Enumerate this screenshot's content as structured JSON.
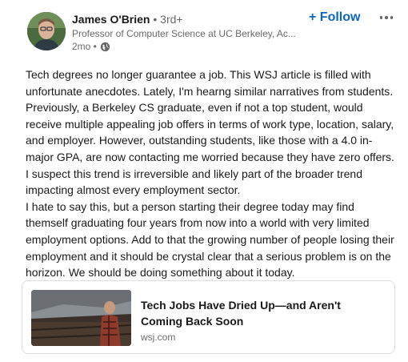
{
  "author": {
    "name": "James O'Brien",
    "degree": " • 3rd+",
    "headline": "Professor of Computer Science at UC Berkeley, Ac...",
    "time": "2mo •"
  },
  "actions": {
    "follow_label": "+ Follow",
    "more_icon": "more-horizontal-icon"
  },
  "post": {
    "paragraphs": [
      "Tech degrees no longer guarantee a job. This WSJ article is filled with unfortunate anecdotes. Lately, I'm hearng similar narratives from students. Previously, a Berkeley CS graduate, even if not a top student, would receive multiple appealing job offers in terms of work type, location, salary, and employer. However, outstanding students, like those with a 4.0 in-major GPA, are now contacting me worried because they have zero offers. I suspect this trend is irreversible and likely part of the broader trend impacting almost every employment sector.",
      "I hate to say this, but a person starting their degree today may find themself graduating four years from now into a world with very limited employment options. Add to that the growing number of people losing their employment and it should be crystal clear that a serious problem is on the horizon. We should be doing something about it today."
    ]
  },
  "article": {
    "title": "Tech Jobs Have Dried Up—and Aren't Coming Back Soon",
    "source": "wsj.com"
  },
  "colors": {
    "accent": "#0a66c2",
    "text": "#191919",
    "muted": "#666666",
    "border": "#e0dfdc"
  }
}
